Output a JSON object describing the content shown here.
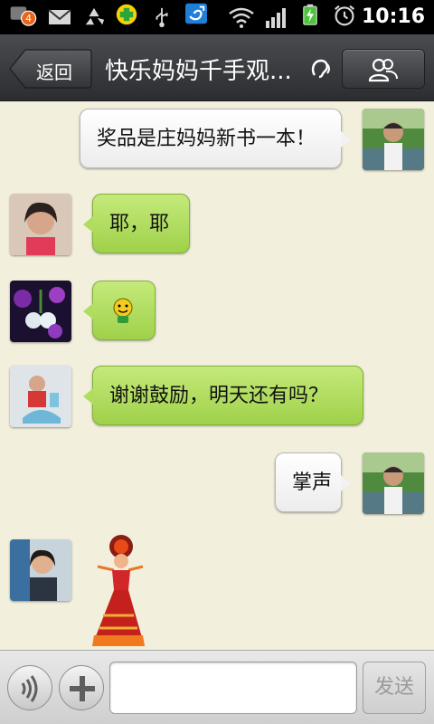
{
  "status_bar": {
    "notification_count": "4",
    "time": "10:16",
    "icons": [
      "notification-badge-icon",
      "mail-icon",
      "recycle-icon",
      "plus-app-icon",
      "usb-icon",
      "app-s-icon",
      "wifi-icon",
      "signal-icon",
      "battery-icon",
      "alarm-icon"
    ]
  },
  "header": {
    "back_label": "返回",
    "title": "快乐妈妈千手观...",
    "icons": [
      "earpiece-icon",
      "contacts-icon"
    ]
  },
  "messages": [
    {
      "direction": "out",
      "sender": "self",
      "text": "奖品是庄妈妈新书一本！"
    },
    {
      "direction": "in",
      "sender": "member-1",
      "text": "耶，耶"
    },
    {
      "direction": "in",
      "sender": "member-2",
      "emoji": "smiley-emoji-icon"
    },
    {
      "direction": "in",
      "sender": "member-3",
      "text": "谢谢鼓励，明天还有吗？"
    },
    {
      "direction": "out",
      "sender": "self",
      "text": "掌声"
    },
    {
      "direction": "in",
      "sender": "member-4",
      "sticker": "dancer-sticker-icon"
    }
  ],
  "input_bar": {
    "value": "",
    "placeholder": "",
    "send_label": "发送",
    "icons": [
      "voice-icon",
      "plus-icon"
    ]
  },
  "colors": {
    "incoming_bubble": "#aedb5a",
    "outgoing_bubble": "#f5f5f5",
    "chat_background": "#f2efdc",
    "title_bar": "#3a3c40"
  }
}
